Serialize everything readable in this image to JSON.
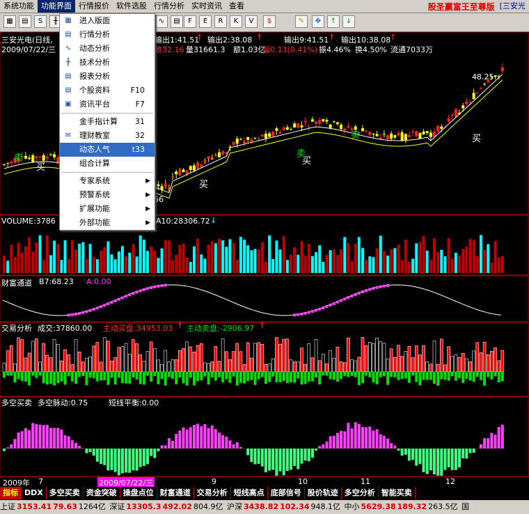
{
  "menubar": {
    "items": [
      "系统功能",
      "功能界面",
      "行情报价",
      "软件选股",
      "行情分析",
      "实时资讯",
      "查看"
    ],
    "brand": "股圣赢富王至尊版",
    "brand2": "[三安光"
  },
  "toolbar": {
    "icons": [
      "grid-icon",
      "table-icon",
      "s-icon",
      "kline-icon",
      "minute-icon",
      "report-icon",
      "f10-icon",
      "eit-icon",
      "rsi-icon",
      "kdj-icon",
      "vol-icon",
      "dollar-icon",
      "pencil-icon",
      "cross-icon",
      "up-arrow-icon",
      "down-arrow-icon"
    ]
  },
  "header": {
    "stock": "三安光电(日线,",
    "date": "2009/07/22/三",
    "signals": [
      "输出1:41.51",
      "输出2:38.08",
      "输出9:41.51",
      "输出10:38.08"
    ],
    "quote": {
      "close": "收32.16",
      "vol": "量31661.3",
      "amount": "额1.03亿",
      "change": "幅0.13(0.41%)",
      "amp": "振4.46%",
      "turnover": "换4.50%",
      "float": "流通7033万"
    },
    "price_high": "48.25",
    "price_low": "66",
    "buy_label": "买",
    "sell_label": "卖"
  },
  "panels": {
    "volume": {
      "title": "VOLUME:3786",
      "ma10": "A10:28306.72"
    },
    "wealth": {
      "title": "财富通道",
      "b7": "B7:68.23",
      "a": "A:0.00"
    },
    "trade": {
      "title": "交易分析",
      "vol": "成交:37860.00",
      "buy": "主动买盘:34953.03",
      "sell": "主动卖盘:-2906.97"
    },
    "longshort": {
      "title": "多空买卖",
      "pulse": "多空脉动:0.75",
      "balance": "短线平衡:0.00"
    }
  },
  "datebar": {
    "year": "2009年",
    "m7": "7",
    "cursor": "2009/07/22/三",
    "m9": "9",
    "m10": "10",
    "m11": "11",
    "m12": "12"
  },
  "tabs": [
    "指标",
    "DDX",
    "多空买卖",
    "资金突破",
    "操盘点位",
    "财富通道",
    "交易分析",
    "短线高点",
    "底部信号",
    "股价轨迹",
    "多空分析",
    "智能买卖"
  ],
  "statusbar": {
    "sh_label": "上证",
    "sh_value": "3153.41",
    "sh_change": "79.63",
    "sh_amount": "1264亿",
    "sz_label": "深证",
    "sz_value": "13305.3",
    "sz_change": "492.02",
    "sz_amount": "804.9亿",
    "hs_label": "沪深",
    "hs_value": "3438.82",
    "hs_change": "102.34",
    "hs_amount": "948.1亿",
    "zx_label": "中小",
    "zx_value": "5629.38",
    "zx_change": "189.32",
    "zx_amount": "263.5亿",
    "extra": "国"
  },
  "dropdown": {
    "items": [
      {
        "label": "进入版面",
        "icon": "layout-icon",
        "shortcut": "",
        "arrow": false
      },
      {
        "label": "行情分析",
        "icon": "table-icon",
        "shortcut": "",
        "arrow": false
      },
      {
        "label": "动态分析",
        "icon": "line-chart-icon",
        "shortcut": "",
        "arrow": false
      },
      {
        "label": "技术分析",
        "icon": "kline-icon",
        "shortcut": "",
        "arrow": false
      },
      {
        "label": "报表分析",
        "icon": "report-icon",
        "shortcut": "",
        "arrow": false
      },
      {
        "label": "个股资料",
        "icon": "doc-icon",
        "shortcut": "F10",
        "arrow": false
      },
      {
        "label": "资讯平台",
        "icon": "news-icon",
        "shortcut": "F7",
        "arrow": false
      },
      {
        "label": "金手指计算",
        "icon": "",
        "shortcut": "31",
        "arrow": false,
        "sep_before": true
      },
      {
        "label": "理财教室",
        "icon": "mail-icon",
        "shortcut": "32",
        "arrow": false
      },
      {
        "label": "动态人气",
        "icon": "",
        "shortcut": "t33",
        "arrow": false,
        "highlight": true
      },
      {
        "label": "组合计算",
        "icon": "",
        "shortcut": "",
        "arrow": false
      },
      {
        "label": "专家系统",
        "icon": "",
        "shortcut": "",
        "arrow": true,
        "sep_before": true
      },
      {
        "label": "预警系统",
        "icon": "",
        "shortcut": "",
        "arrow": true
      },
      {
        "label": "扩展功能",
        "icon": "",
        "shortcut": "",
        "arrow": true
      },
      {
        "label": "外部功能",
        "icon": "",
        "shortcut": "",
        "arrow": true
      }
    ]
  },
  "colors": {
    "up": "#ff2020",
    "down": "#00ffff",
    "yellow": "#ffff00",
    "magenta": "#ff40ff",
    "green": "#00e000",
    "white": "#ffffff"
  }
}
